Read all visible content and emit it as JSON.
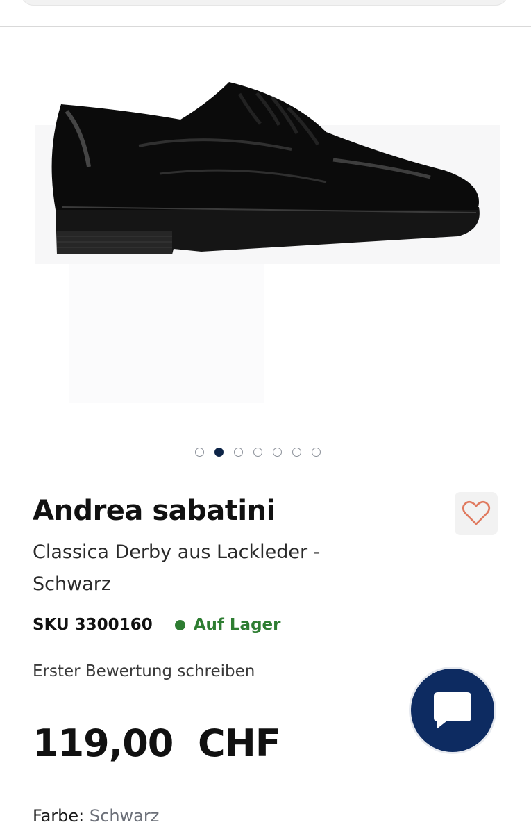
{
  "carousel": {
    "total": 7,
    "active_index": 2
  },
  "product": {
    "brand": "Andrea sabatini",
    "name": "Classica Derby aus Lackleder - Schwarz",
    "sku_label": "SKU",
    "sku": "3300160",
    "stock_status": "Auf Lager",
    "review_link": "Erster Bewertung schreiben",
    "price": "119,00  CHF",
    "color_label": "Farbe:",
    "color_value": "Schwarz"
  },
  "icons": {
    "wishlist": "heart-icon",
    "chat": "chat-bubble-icon"
  },
  "colors": {
    "accent_navy": "#0d2b61",
    "stock_green": "#2e7d32",
    "heart": "#e07a5f"
  }
}
